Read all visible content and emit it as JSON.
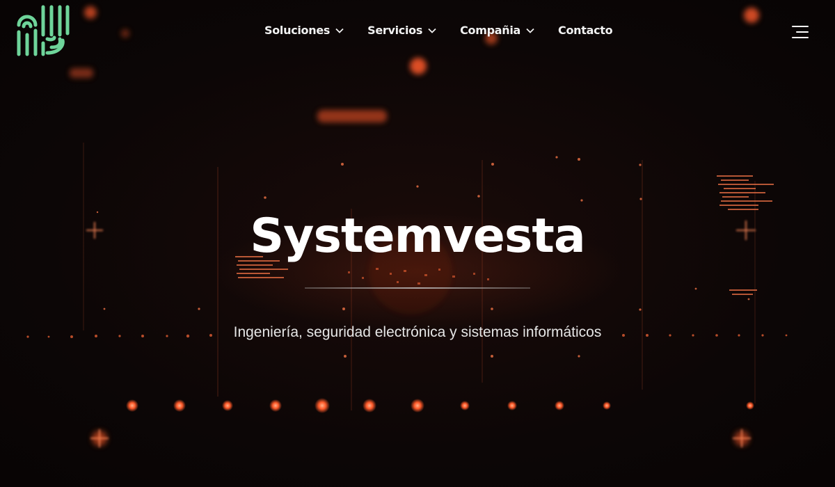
{
  "brand": {
    "logo_icon": "fingerprint-logo-icon",
    "logo_color": "#6ed49a"
  },
  "nav": {
    "items": [
      {
        "label": "Soluciones",
        "has_dropdown": true
      },
      {
        "label": "Servicios",
        "has_dropdown": true
      },
      {
        "label": "Compañia",
        "has_dropdown": true
      },
      {
        "label": "Contacto",
        "has_dropdown": false
      }
    ],
    "menu_icon": "menu-icon"
  },
  "hero": {
    "title": "Systemvesta",
    "subtitle": "Ingeniería, seguridad electrónica y sistemas informáticos"
  },
  "colors": {
    "background": "#0a0606",
    "glow": "#ff5a2a",
    "text": "#ffffff"
  }
}
